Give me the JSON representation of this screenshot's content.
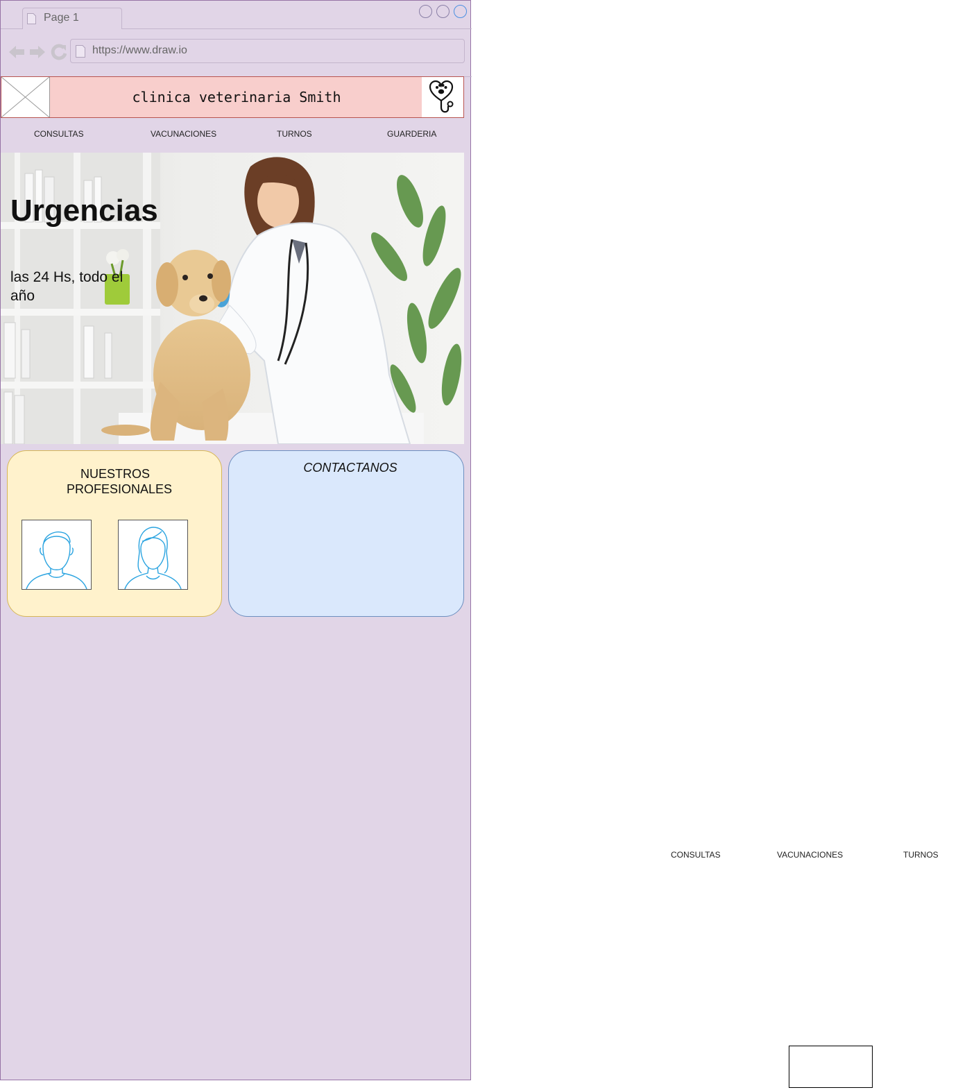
{
  "browser": {
    "tab_label": "Page 1",
    "url": "https://www.draw.io"
  },
  "header": {
    "title": "clinica veterinaria Smith",
    "logo_icon": "vet-stethoscope-paw-icon"
  },
  "nav": {
    "items": [
      "CONSULTAS",
      "VACUNACIONES",
      "TURNOS",
      "GUARDERIA"
    ]
  },
  "hero": {
    "title": "Urgencias",
    "subtitle": "las 24 Hs, todo el año"
  },
  "professionals": {
    "title": "NUESTROS PROFESIONALES"
  },
  "contact": {
    "title": "CONTACTANOS"
  },
  "secondary_nav": {
    "items": [
      "CONSULTAS",
      "VACUNACIONES",
      "TURNOS"
    ]
  },
  "colors": {
    "browser_bg": "#e1d5e7",
    "header_bg": "#f8cecc",
    "pros_bg": "#fff2cc",
    "contact_bg": "#dae8fc"
  }
}
